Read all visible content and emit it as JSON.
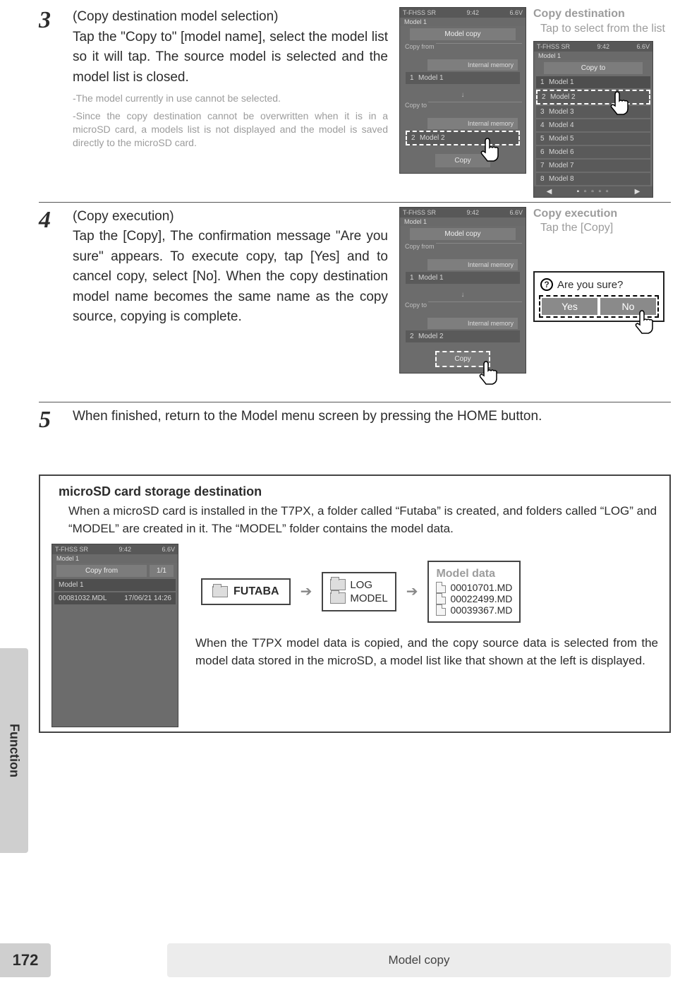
{
  "page": {
    "side_tab": "Function",
    "page_number": "172",
    "footer_label": "Model copy"
  },
  "step3": {
    "number": "3",
    "head": "(Copy destination model selection)",
    "body": "Tap the \"Copy to\" [model name], select the model list so it will tap. The source model is selected and the model list is closed.",
    "note1": "-The model currently in use cannot be selected.",
    "note2": "-Since the copy destination cannot be overwritten when it is in a microSD card, a models list is not displayed and the model is saved directly to the microSD card.",
    "aside_t": "Copy destination",
    "aside_s": "Tap to select from the list"
  },
  "device_common": {
    "top_l": "T-FHSS SR",
    "top_c": "9:42",
    "top_r": "6.6V",
    "sub": "Model 1",
    "title": "Model copy",
    "from": "Copy from",
    "to": "Copy to",
    "mem": "Internal memory",
    "m1": "Model 1",
    "m2": "Model 2",
    "copy": "Copy",
    "arrow": "↓"
  },
  "device_list": {
    "title": "Copy to",
    "items": [
      "Model 1",
      "Model 2",
      "Model 3",
      "Model 4",
      "Model 5",
      "Model 6",
      "Model 7",
      "Model 8"
    ]
  },
  "step4": {
    "number": "4",
    "head": "(Copy execution)",
    "body": "Tap the [Copy], The confirmation message \"Are you sure\" appears. To execute copy, tap [Yes] and to cancel copy, select [No]. When the copy destination model name becomes the same name as the copy source, copying is complete.",
    "aside_t": "Copy execution",
    "aside_s": "Tap the [Copy]"
  },
  "dialog": {
    "q": "Are you sure?",
    "yes": "Yes",
    "no": "No"
  },
  "step5": {
    "number": "5",
    "body": "When finished, return to the Model menu screen by pressing the HOME button."
  },
  "sd": {
    "head": "microSD card storage destination",
    "body": "When a microSD card is installed in the T7PX, a folder called “Futaba” is created, and folders called “LOG” and “MODEL” are created in it. The “MODEL” folder contains the model data.",
    "sc_title": "Copy from",
    "sc_page": "1/1",
    "sc_row_m": "Model 1",
    "sc_row_file": "00081032.MDL",
    "sc_row_date": "17/06/21 14:26",
    "futaba": "FUTABA",
    "log": "LOG",
    "model": "MODEL",
    "mdbox_t": "Model data",
    "mdbox_files": [
      "00010701.MD",
      "00022499.MD",
      "00039367.MD"
    ],
    "after": "When the T7PX model data is copied, and the copy source data is selected from the model data stored in the microSD, a model list like that shown at the left is displayed."
  }
}
